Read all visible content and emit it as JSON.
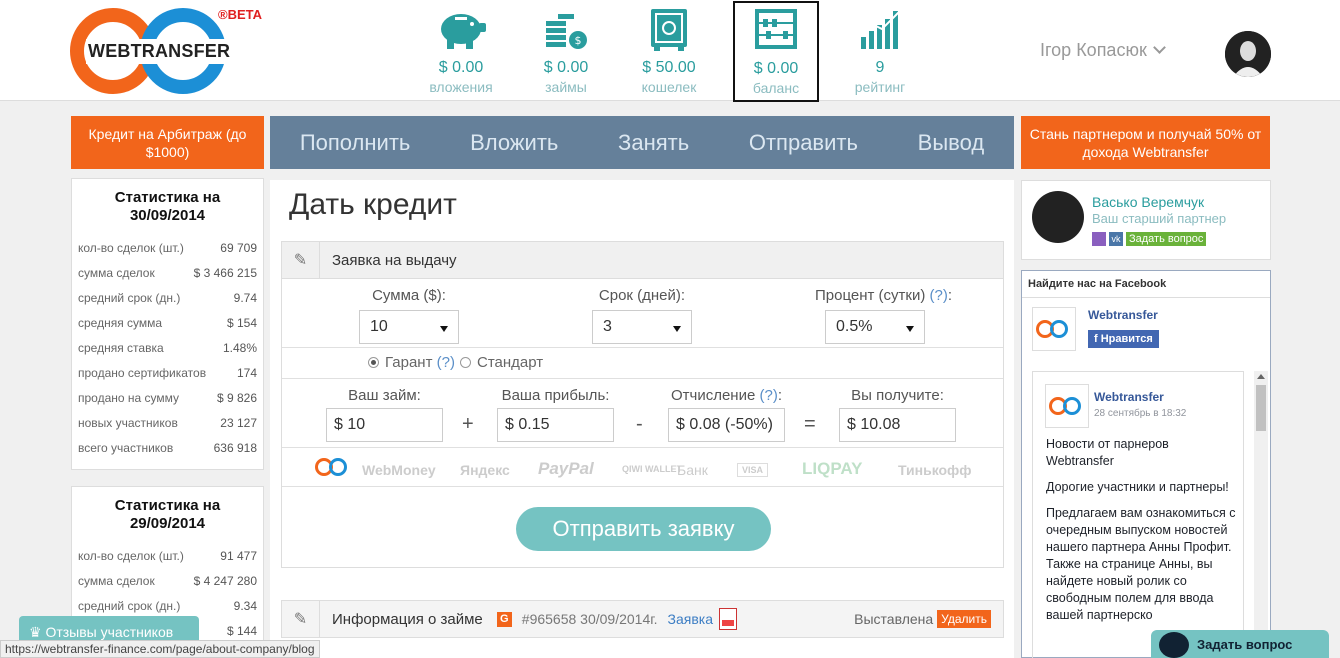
{
  "brand": {
    "logo_text": "WEBTRANSFER",
    "beta": "®BETA"
  },
  "topstats": [
    {
      "value": "$ 0.00",
      "label": "вложения",
      "icon": "piggy-bank-icon"
    },
    {
      "value": "$ 0.00",
      "label": "займы",
      "icon": "coins-icon"
    },
    {
      "value": "$ 50.00",
      "label": "кошелек",
      "icon": "safe-icon"
    },
    {
      "value": "$ 0.00",
      "label": "баланс",
      "icon": "abacus-icon"
    },
    {
      "value": "9",
      "label": "рейтинг",
      "icon": "rating-chart-icon"
    }
  ],
  "user": {
    "name": "Ігор Копасюк"
  },
  "promo_left": "Кредит на Арбитраж (до $1000)",
  "promo_right": "Стань партнером и получай 50% от дохода Webtransfer",
  "nav": [
    "Пополнить",
    "Вложить",
    "Занять",
    "Отправить",
    "Вывод"
  ],
  "stats": [
    {
      "title": "Статистика на 30/09/2014",
      "rows": [
        [
          "кол-во сделок (шт.)",
          "69 709"
        ],
        [
          "сумма сделок",
          "$ 3 466 215"
        ],
        [
          "средний срок (дн.)",
          "9.74"
        ],
        [
          "средняя сумма",
          "$ 154"
        ],
        [
          "средняя ставка",
          "1.48%"
        ],
        [
          "продано сертификатов",
          "174"
        ],
        [
          "продано на сумму",
          "$ 9 826"
        ],
        [
          "новых участников",
          "23 127"
        ],
        [
          "всего участников",
          "636 918"
        ]
      ]
    },
    {
      "title": "Статистика на 29/09/2014",
      "rows": [
        [
          "кол-во сделок (шт.)",
          "91 477"
        ],
        [
          "сумма сделок",
          "$ 4 247 280"
        ],
        [
          "средний срок (дн.)",
          "9.34"
        ],
        [
          "",
          "$ 144"
        ]
      ]
    }
  ],
  "page_title": "Дать кредит",
  "form": {
    "panel_title": "Заявка на выдачу",
    "amount_label": "Сумма ($):",
    "amount_value": "10",
    "term_label": "Срок (дней):",
    "term_value": "3",
    "rate_label": "Процент (сутки)",
    "rate_help": "(?)",
    "rate_colon": ":",
    "rate_value": "0.5%",
    "radio_guarant": "Гарант",
    "radio_help": "(?)",
    "radio_standard": "Стандарт",
    "loan_label": "Ваш займ:",
    "loan_value": "$ 10",
    "profit_label": "Ваша прибыль:",
    "profit_value": "$ 0.15",
    "fee_label": "Отчисление",
    "fee_help": "(?)",
    "fee_colon": ":",
    "fee_value": "$ 0.08 (-50%)",
    "receive_label": "Вы получите:",
    "receive_value": "$ 10.08",
    "op_plus": "+",
    "op_minus": "-",
    "op_eq": "=",
    "submit": "Отправить заявку"
  },
  "payments": [
    "WebMoney",
    "Яндекс",
    "PayPal",
    "QIWI WALLET",
    "Банк",
    "VISA",
    "LIQPAY",
    "Тинькофф"
  ],
  "loan_info": {
    "title": "Информация о займе",
    "badge": "G",
    "number": "#965658 30/09/2014г.",
    "link": "Заявка",
    "status": "Выставлена",
    "delete": "Удалить"
  },
  "partner": {
    "name": "Васько Веремчук",
    "role": "Ваш старший партнер",
    "ask": "Задать вопрос"
  },
  "facebook": {
    "header": "Найдите нас на Facebook",
    "page_name": "Webtransfer",
    "like": "Нравится",
    "post_name": "Webtransfer",
    "post_date": "28 сентябрь в 18:32",
    "p1": "Новости от парнеров Webtransfer",
    "p2": "Дорогие участники и партнеры!",
    "p3": "Предлагаем вам ознакомиться с очередным выпуском новостей нашего партнера Анны Профит. Также на странице Анны, вы найдете новый ролик со свободным полем для ввода вашей партнерско"
  },
  "reviews_tab": "Отзывы участников",
  "status_url": "https://webtransfer-finance.com/page/about-company/blog",
  "chat_label": "Задать вопрос",
  "colors": {
    "orange": "#f2651b",
    "teal": "#2a9d9e",
    "nav": "#65809a",
    "blue": "#1c8fd6"
  }
}
